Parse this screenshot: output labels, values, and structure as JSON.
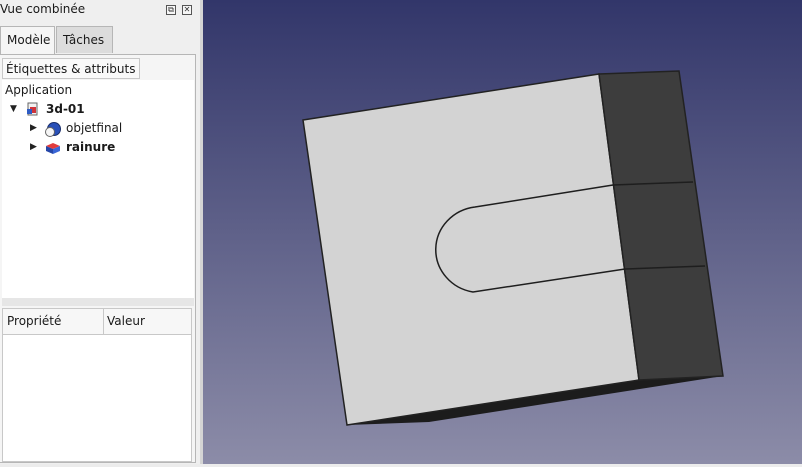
{
  "panel": {
    "title": "Vue combinée",
    "float_glyph": "⧉",
    "close_glyph": "✕",
    "tabs": [
      {
        "label": "Modèle",
        "active": true
      },
      {
        "label": "Tâches",
        "active": false
      }
    ],
    "tree_header": "Étiquettes & attributs",
    "tree": {
      "root": "Application",
      "document": {
        "label": "3d-01",
        "icon": "document-icon"
      },
      "items": [
        {
          "label": "objetfinal",
          "icon": "boolean-cut-icon",
          "bold": false
        },
        {
          "label": "rainure",
          "icon": "part-box-icon",
          "bold": true
        }
      ]
    },
    "property_table": {
      "columns": [
        "Propriété",
        "Valeur"
      ]
    }
  },
  "viewport": {
    "background_top": "#32366a",
    "background_bottom": "#8c8ca8",
    "face_color": "#d4d4d4",
    "side_color": "#3c3c3c"
  }
}
